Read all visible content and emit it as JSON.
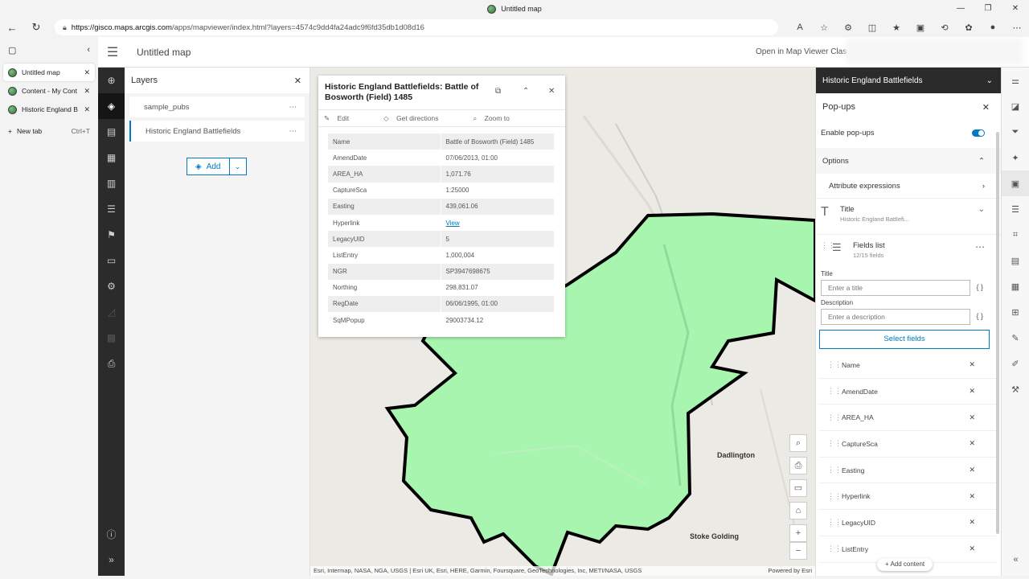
{
  "browser": {
    "window_title": "Untitled map",
    "url_host": "https://gisco.maps.arcgis.com",
    "url_path": "/apps/mapviewer/index.html?layers=4574c9dd4fa24adc9f6fd35db1d08d16",
    "tabs": [
      {
        "label": "Untitled map",
        "active": true
      },
      {
        "label": "Content - My Cont",
        "active": false
      },
      {
        "label": "Historic England B",
        "active": false
      }
    ],
    "new_tab_label": "New tab",
    "new_tab_shortcut": "Ctrl+T"
  },
  "app": {
    "map_title": "Untitled map",
    "open_in_classic": "Open in Map Viewer Clas"
  },
  "layers_panel": {
    "title": "Layers",
    "layers": [
      {
        "name": "sample_pubs",
        "selected": false
      },
      {
        "name": "Historic England Battlefields",
        "selected": true
      }
    ],
    "add_label": "Add"
  },
  "map": {
    "labels": [
      "Dadlington",
      "Stoke Golding"
    ],
    "attribution": "Esri, Intermap, NASA, NGA, USGS | Esri UK, Esri, HERE, Garmin, Foursquare, GeoTechnologies, Inc, METI/NASA, USGS",
    "powered_by": "Powered by Esri",
    "fill_color": "#a8f5b0",
    "outline_color": "#000000"
  },
  "popup": {
    "title": "Historic England Battlefields: Battle of Bosworth (Field) 1485",
    "actions": [
      "Edit",
      "Get directions",
      "Zoom to"
    ],
    "rows": [
      {
        "key": "Name",
        "value": "Battle of Bosworth (Field) 1485"
      },
      {
        "key": "AmendDate",
        "value": "07/06/2013, 01:00"
      },
      {
        "key": "AREA_HA",
        "value": "1,071.76"
      },
      {
        "key": "CaptureSca",
        "value": "1:25000"
      },
      {
        "key": "Easting",
        "value": "439,061.06"
      },
      {
        "key": "Hyperlink",
        "value": "View"
      },
      {
        "key": "LegacyUID",
        "value": "5"
      },
      {
        "key": "ListEntry",
        "value": "1,000,004"
      },
      {
        "key": "NGR",
        "value": "SP3947698675"
      },
      {
        "key": "Northing",
        "value": "298,831.07"
      },
      {
        "key": "RegDate",
        "value": "06/06/1995, 01:00"
      },
      {
        "key": "SqMPopup",
        "value": "29003734.12"
      }
    ]
  },
  "config_panel": {
    "layer_name": "Historic England Battlefields",
    "panel_title": "Pop-ups",
    "enable_label": "Enable pop-ups",
    "options_label": "Options",
    "attribute_expressions": "Attribute expressions",
    "title_block": {
      "label": "Title",
      "value": "Historic England Battlefi..."
    },
    "fields_list": {
      "label": "Fields list",
      "count": "12/15 fields"
    },
    "title_field_label": "Title",
    "title_placeholder": "Enter a title",
    "description_label": "Description",
    "description_placeholder": "Enter a description",
    "brace": "{ }",
    "select_fields": "Select fields",
    "fields": [
      "Name",
      "AmendDate",
      "AREA_HA",
      "CaptureSca",
      "Easting",
      "Hyperlink",
      "LegacyUID",
      "ListEntry"
    ],
    "add_content": "+ Add content"
  }
}
